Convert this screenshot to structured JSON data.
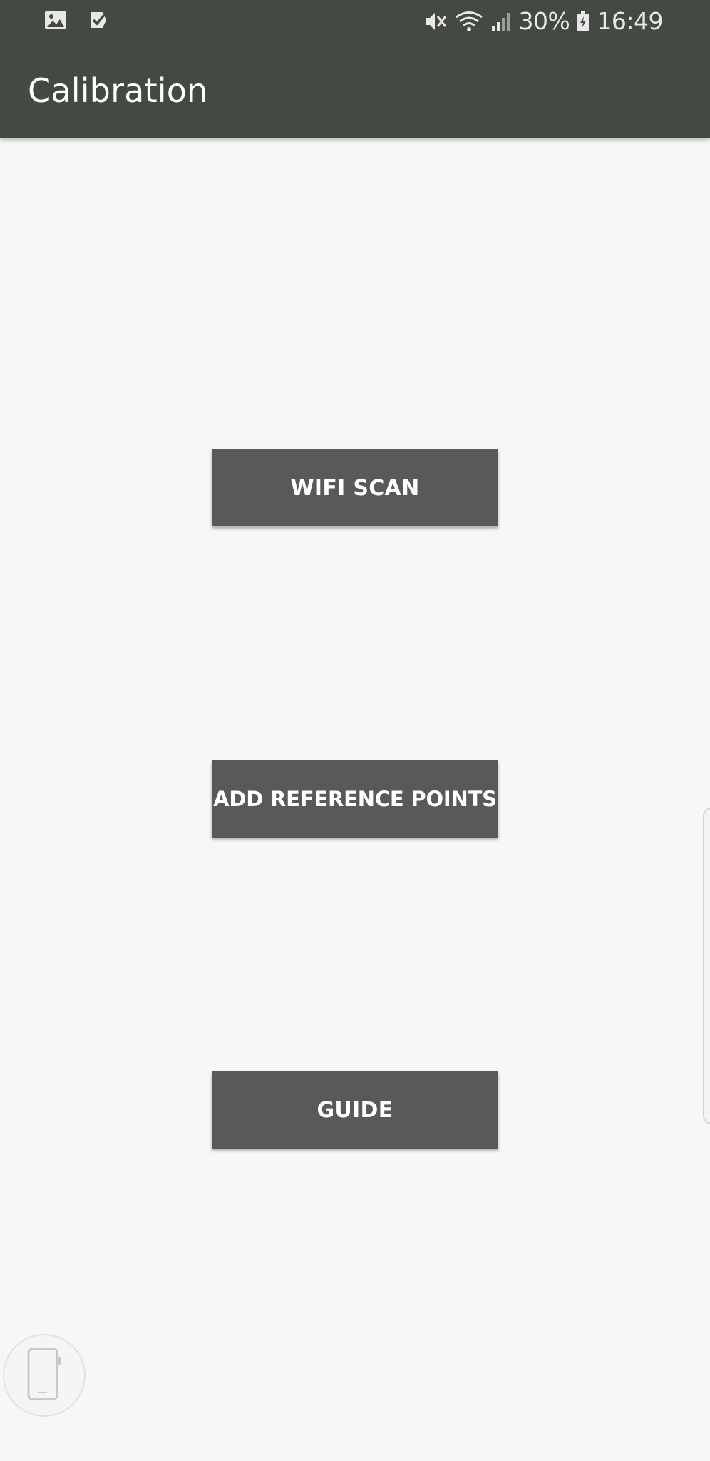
{
  "status_bar": {
    "time": "16:49",
    "battery": "30%",
    "icons": [
      "gallery-icon",
      "task-check-icon",
      "mute-icon",
      "wifi-icon",
      "signal-icon",
      "battery-charging-icon"
    ]
  },
  "app_bar": {
    "title": "Calibration"
  },
  "buttons": {
    "wifi_scan": "WIFI SCAN",
    "add_reference_points": "ADD REFERENCE POINTS",
    "guide": "GUIDE"
  },
  "colors": {
    "app_bar": "#444a41",
    "background": "#f7f7f7",
    "button": "#595959",
    "button_text": "#ffffff"
  },
  "overlays": {
    "floating_icon": "phone-icon",
    "edge_panel": "edge-panel-handle"
  }
}
